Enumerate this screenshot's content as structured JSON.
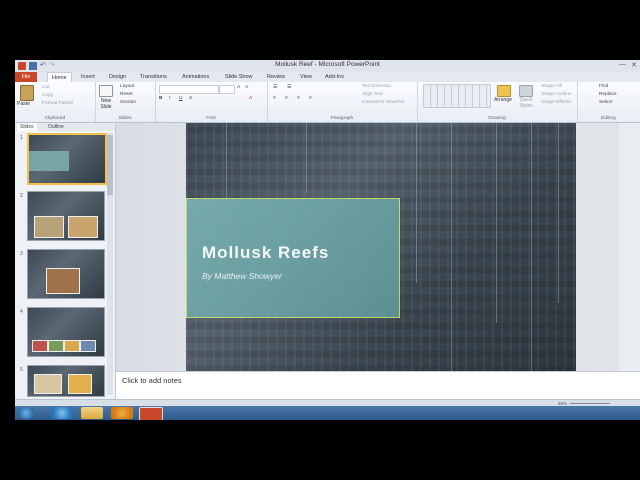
{
  "window": {
    "title": "Mollusk Reef - Microsoft PowerPoint",
    "minimize_icon": "minimize-icon",
    "close_icon": "close-icon"
  },
  "ribbon_tabs": [
    {
      "label": "File"
    },
    {
      "label": "Home"
    },
    {
      "label": "Insert"
    },
    {
      "label": "Design"
    },
    {
      "label": "Transitions"
    },
    {
      "label": "Animations"
    },
    {
      "label": "Slide Show"
    },
    {
      "label": "Review"
    },
    {
      "label": "View"
    },
    {
      "label": "Add-Ins"
    }
  ],
  "ribbon": {
    "clipboard": {
      "group_label": "Clipboard",
      "paste": "Paste",
      "cut": "Cut",
      "copy": "Copy",
      "format_painter": "Format Painter"
    },
    "slides": {
      "group_label": "Slides",
      "new_slide": "New Slide",
      "layout": "Layout",
      "reset": "Reset",
      "section": "Section"
    },
    "font": {
      "group_label": "Font"
    },
    "paragraph": {
      "group_label": "Paragraph",
      "text_direction": "Text Direction",
      "align_text": "Align Text",
      "convert": "Convert to SmartArt"
    },
    "drawing": {
      "group_label": "Drawing",
      "arrange": "Arrange",
      "quick_styles": "Quick Styles",
      "shape_fill": "Shape Fill",
      "shape_outline": "Shape Outline",
      "shape_effects": "Shape Effects"
    },
    "editing": {
      "group_label": "Editing",
      "find": "Find",
      "replace": "Replace",
      "select": "Select"
    }
  },
  "left_pane": {
    "tabs": [
      "Slides",
      "Outline"
    ],
    "slide_numbers": [
      "1",
      "2",
      "3",
      "4",
      "5"
    ]
  },
  "slide": {
    "title": "Mollusk Reefs",
    "subtitle": "By Matthew Showyer"
  },
  "notes": {
    "placeholder": "Click to add notes"
  },
  "status_bar": {
    "zoom": "46%"
  },
  "colors": {
    "file_tab": "#c9472a",
    "title_box": "#7fb0b0",
    "title_box_border": "#c7d86a",
    "taskbar": "#2d5a8a"
  }
}
